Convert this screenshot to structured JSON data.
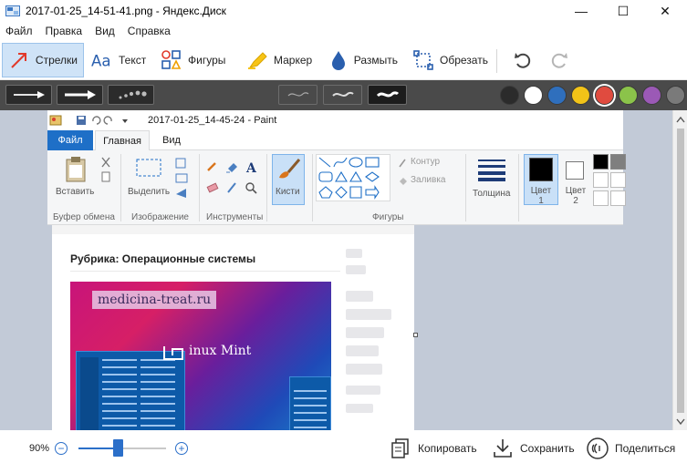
{
  "window": {
    "title": "2017-01-25_14-51-41.png - Яндекс.Диск",
    "minimize": "—",
    "maximize": "☐",
    "close": "✕"
  },
  "menu": {
    "items": [
      "Файл",
      "Правка",
      "Вид",
      "Справка"
    ]
  },
  "toolbar": {
    "arrows_label": "Стрелки",
    "text_label": "Текст",
    "shapes_label": "Фигуры",
    "marker_label": "Маркер",
    "blur_label": "Размыть",
    "crop_label": "Обрезать"
  },
  "palette": {
    "colors": [
      "#2b2b2b",
      "#ffffff",
      "#2f6fbd",
      "#f2c318",
      "#e04b3f",
      "#8bc34a",
      "#9b59b6",
      "#7a7a7a"
    ]
  },
  "paint": {
    "title": "2017-01-25_14-45-24 - Paint",
    "tab_file": "Файл",
    "tab_home": "Главная",
    "tab_view": "Вид",
    "paste": "Вставить",
    "select": "Выделить",
    "brushes": "Кисти",
    "outline": "Контур",
    "fill": "Заливка",
    "thickness": "Толщина",
    "color1": "Цвет 1",
    "color2": "Цвет 2",
    "group_clipboard": "Буфер обмена",
    "group_image": "Изображение",
    "group_tools": "Инструменты",
    "group_shapes": "Фигуры"
  },
  "page": {
    "rubric": "Рубрика: Операционные системы",
    "site_banner": "medicina-treat.ru",
    "distro": "inux Mint"
  },
  "status": {
    "zoom": "90%",
    "zoom_out": "−",
    "zoom_in": "+",
    "zoom_level": 0.45,
    "copy_label": "Копировать",
    "save_label": "Сохранить",
    "share_label": "Поделиться"
  }
}
